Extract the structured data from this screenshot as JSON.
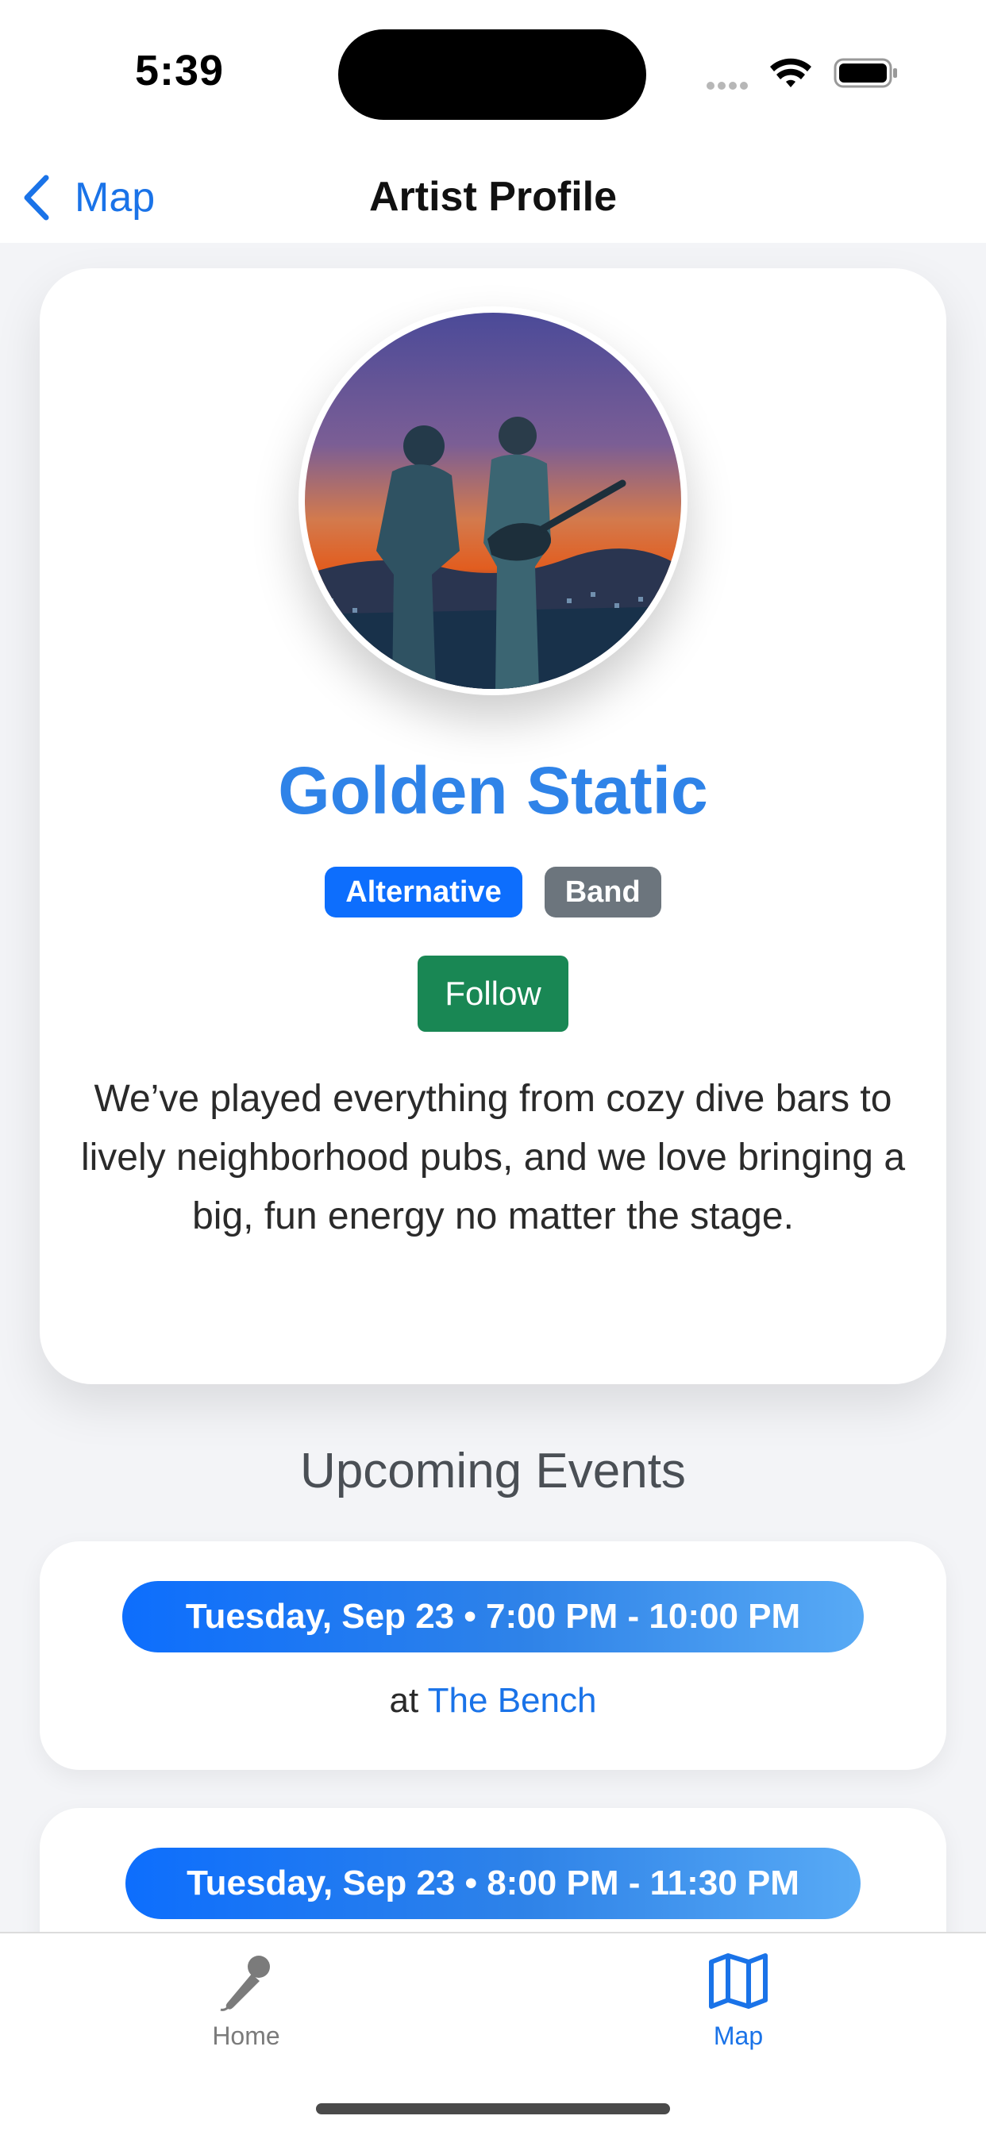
{
  "status_bar": {
    "time": "5:39"
  },
  "nav": {
    "back_label": "Map",
    "title": "Artist Profile"
  },
  "profile": {
    "avatar_icon": "band-photo",
    "name": "Golden Static",
    "tags": [
      "Alternative",
      "Band"
    ],
    "follow_label": "Follow",
    "bio": "We’ve played everything from cozy dive bars to lively neighborhood pubs, and we love bringing a big, fun energy no matter the stage."
  },
  "events": {
    "heading": "Upcoming Events",
    "items": [
      {
        "date_time": "Tuesday, Sep 23 • 7:00 PM - 10:00 PM",
        "at": "at",
        "venue": "The Bench"
      },
      {
        "date_time": "Tuesday, Sep 23 • 8:00 PM - 11:30 PM"
      }
    ]
  },
  "tab_bar": {
    "tabs": [
      {
        "label": "Home",
        "icon": "microphone-icon",
        "active": false
      },
      {
        "label": "Map",
        "icon": "map-icon",
        "active": true
      }
    ]
  },
  "colors": {
    "accent": "#1a73e8",
    "artist_name": "#2f83e8",
    "genre_tag": "#0d6efd",
    "type_tag": "#6c757d",
    "follow": "#198754"
  }
}
